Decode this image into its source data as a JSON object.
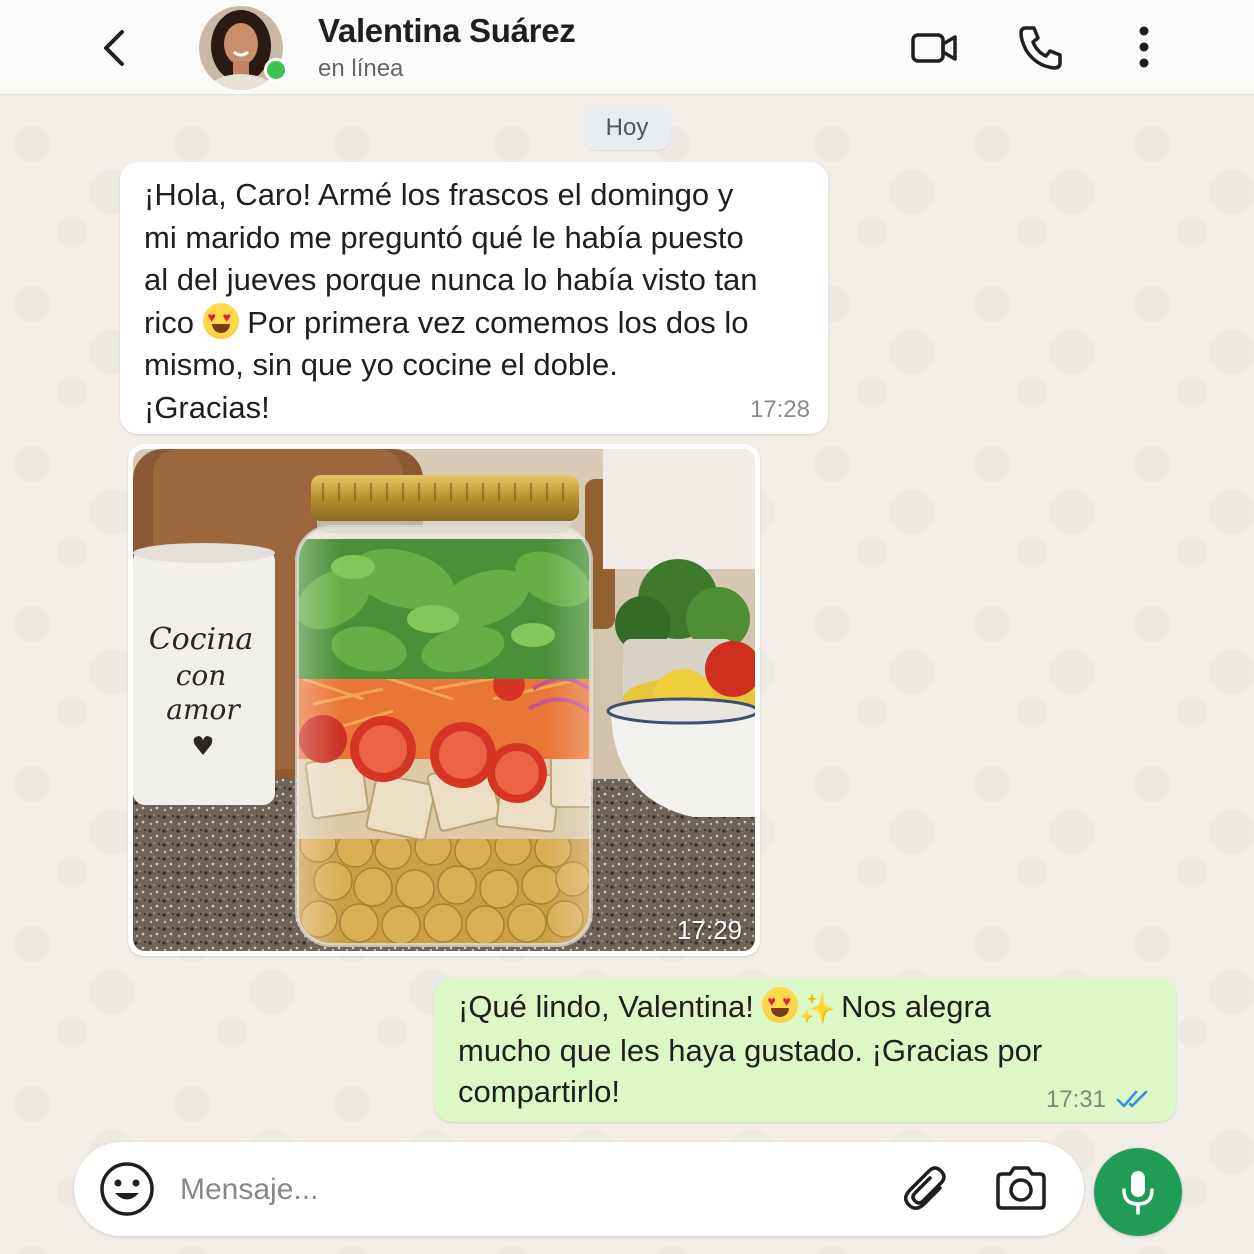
{
  "header": {
    "contact_name": "Valentina Suárez",
    "status": "en línea"
  },
  "date_chip": "Hoy",
  "messages": [
    {
      "direction": "incoming",
      "lines": [
        "¡Hola, Caro! Armé los frascos el domingo y",
        "mi marido me preguntó qué le había puesto",
        "al del jueves porque nunca lo había visto tan",
        "rico",
        "Por primera vez comemos los dos lo",
        "mismo, sin que yo cocine el doble.",
        "¡Gracias!"
      ],
      "emoji": "heart-eyes",
      "time": "17:28"
    },
    {
      "direction": "incoming",
      "type": "photo",
      "photo_label": "Cocina con amor",
      "time": "17:29"
    },
    {
      "direction": "outgoing",
      "line1_a": "¡Qué lindo, Valentina!",
      "line1_b": "Nos alegra",
      "line2": "mucho que les haya gustado. ¡Gracias por",
      "line3": "compartirlo!",
      "emojis": [
        "heart-eyes",
        "sparkles"
      ],
      "time": "17:31",
      "read_status": "read"
    }
  ],
  "composer": {
    "placeholder": "Mensaje..."
  },
  "colors": {
    "accent": "#1f9d57",
    "outgoing_bubble": "#dcf8c6",
    "read_ticks": "#3a8fd9",
    "online": "#3cc24f"
  },
  "icons": [
    "back-icon",
    "video-call-icon",
    "phone-icon",
    "more-options-icon",
    "emoji-icon",
    "attach-icon",
    "camera-icon",
    "mic-icon"
  ]
}
